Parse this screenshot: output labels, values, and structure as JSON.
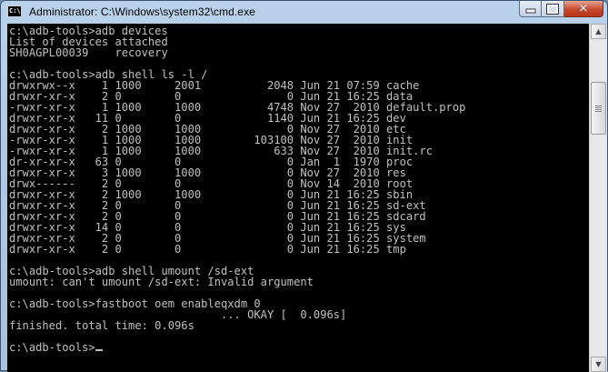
{
  "window": {
    "title": "Administrator: C:\\Windows\\system32\\cmd.exe",
    "icon": "cmd-icon",
    "controls": {
      "minimize": "minimize-icon",
      "maximize": "maximize-icon",
      "close": "close-icon"
    }
  },
  "console": {
    "lines": [
      "c:\\adb-tools>adb devices",
      "List of devices attached",
      "SH0AGPL00039    recovery",
      "",
      "c:\\adb-tools>adb shell ls -l /",
      "drwxrwx--x    1 1000     2001          2048 Jun 21 07:59 cache",
      "drwxr-xr-x    2 0        0                0 Jun 21 16:25 data",
      "-rwxr-xr-x    1 1000     1000          4748 Nov 27  2010 default.prop",
      "drwxr-xr-x   11 0        0             1140 Jun 21 16:25 dev",
      "drwxr-xr-x    2 1000     1000             0 Nov 27  2010 etc",
      "-rwxr-xr-x    1 1000     1000        103100 Nov 27  2010 init",
      "-rwxr-xr-x    1 1000     1000           633 Nov 27  2010 init.rc",
      "dr-xr-xr-x   63 0        0                0 Jan  1  1970 proc",
      "drwxr-xr-x    3 1000     1000             0 Nov 27  2010 res",
      "drwx------    2 0        0                0 Nov 14  2010 root",
      "drwxr-xr-x    2 1000     1000             0 Jun 21 16:25 sbin",
      "drwxr-xr-x    2 0        0                0 Jun 21 16:25 sd-ext",
      "drwxr-xr-x    2 0        0                0 Jun 21 16:25 sdcard",
      "drwxr-xr-x   14 0        0                0 Jun 21 16:25 sys",
      "drwxr-xr-x    2 0        0                0 Jun 21 16:25 system",
      "drwxr-xr-x    2 0        0                0 Jun 21 16:25 tmp",
      "",
      "c:\\adb-tools>adb shell umount /sd-ext",
      "umount: can't umount /sd-ext: Invalid argument",
      "",
      "c:\\adb-tools>fastboot oem enableqxdm 0",
      "                                ... OKAY [  0.096s]",
      "finished. total time: 0.096s",
      "",
      "c:\\adb-tools>"
    ],
    "cursor": "_"
  },
  "scrollbar": {
    "up_icon": "scroll-up-arrow-icon",
    "down_icon": "scroll-down-arrow-icon"
  },
  "colors": {
    "console_bg": "#000000",
    "console_text": "#c0c0c0",
    "close_button": "#c74a2e"
  }
}
